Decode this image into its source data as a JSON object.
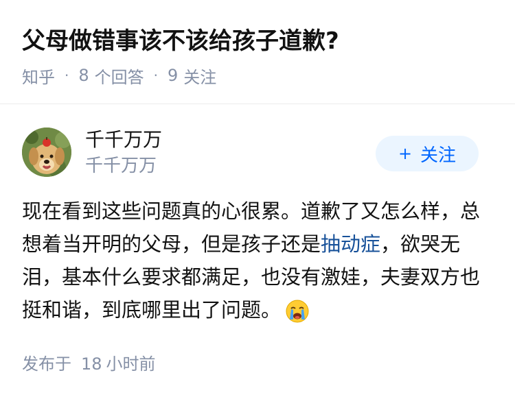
{
  "question": {
    "title": "父母做错事该不该给孩子道歉?",
    "source": "知乎",
    "answers_count": "8",
    "answers_label": "个回答",
    "followers_count": "9",
    "followers_label": "关注"
  },
  "answer": {
    "author_name": "千千万万",
    "author_subtitle": "千千万万",
    "follow_plus": "+",
    "follow_label": "关注",
    "content": {
      "part1": "现在看到这些问题真的心很累。道歉了又怎么样，总想着当开明的父母，但是孩子还是",
      "link": "抽动症",
      "part2": "，欲哭无泪，基本什么要求都满足，也没有激娃，夫妻双方也挺和谐，到底哪里出了问题。"
    },
    "emoji_icon": "crying-face-emoji",
    "posted_prefix": "发布于",
    "posted_num": "18",
    "posted_suffix": "小时前"
  },
  "colors": {
    "title": "#121212",
    "meta": "#8590a6",
    "link": "#175199",
    "follow_bg": "#ebf5ff",
    "follow_text": "#0066ff"
  }
}
